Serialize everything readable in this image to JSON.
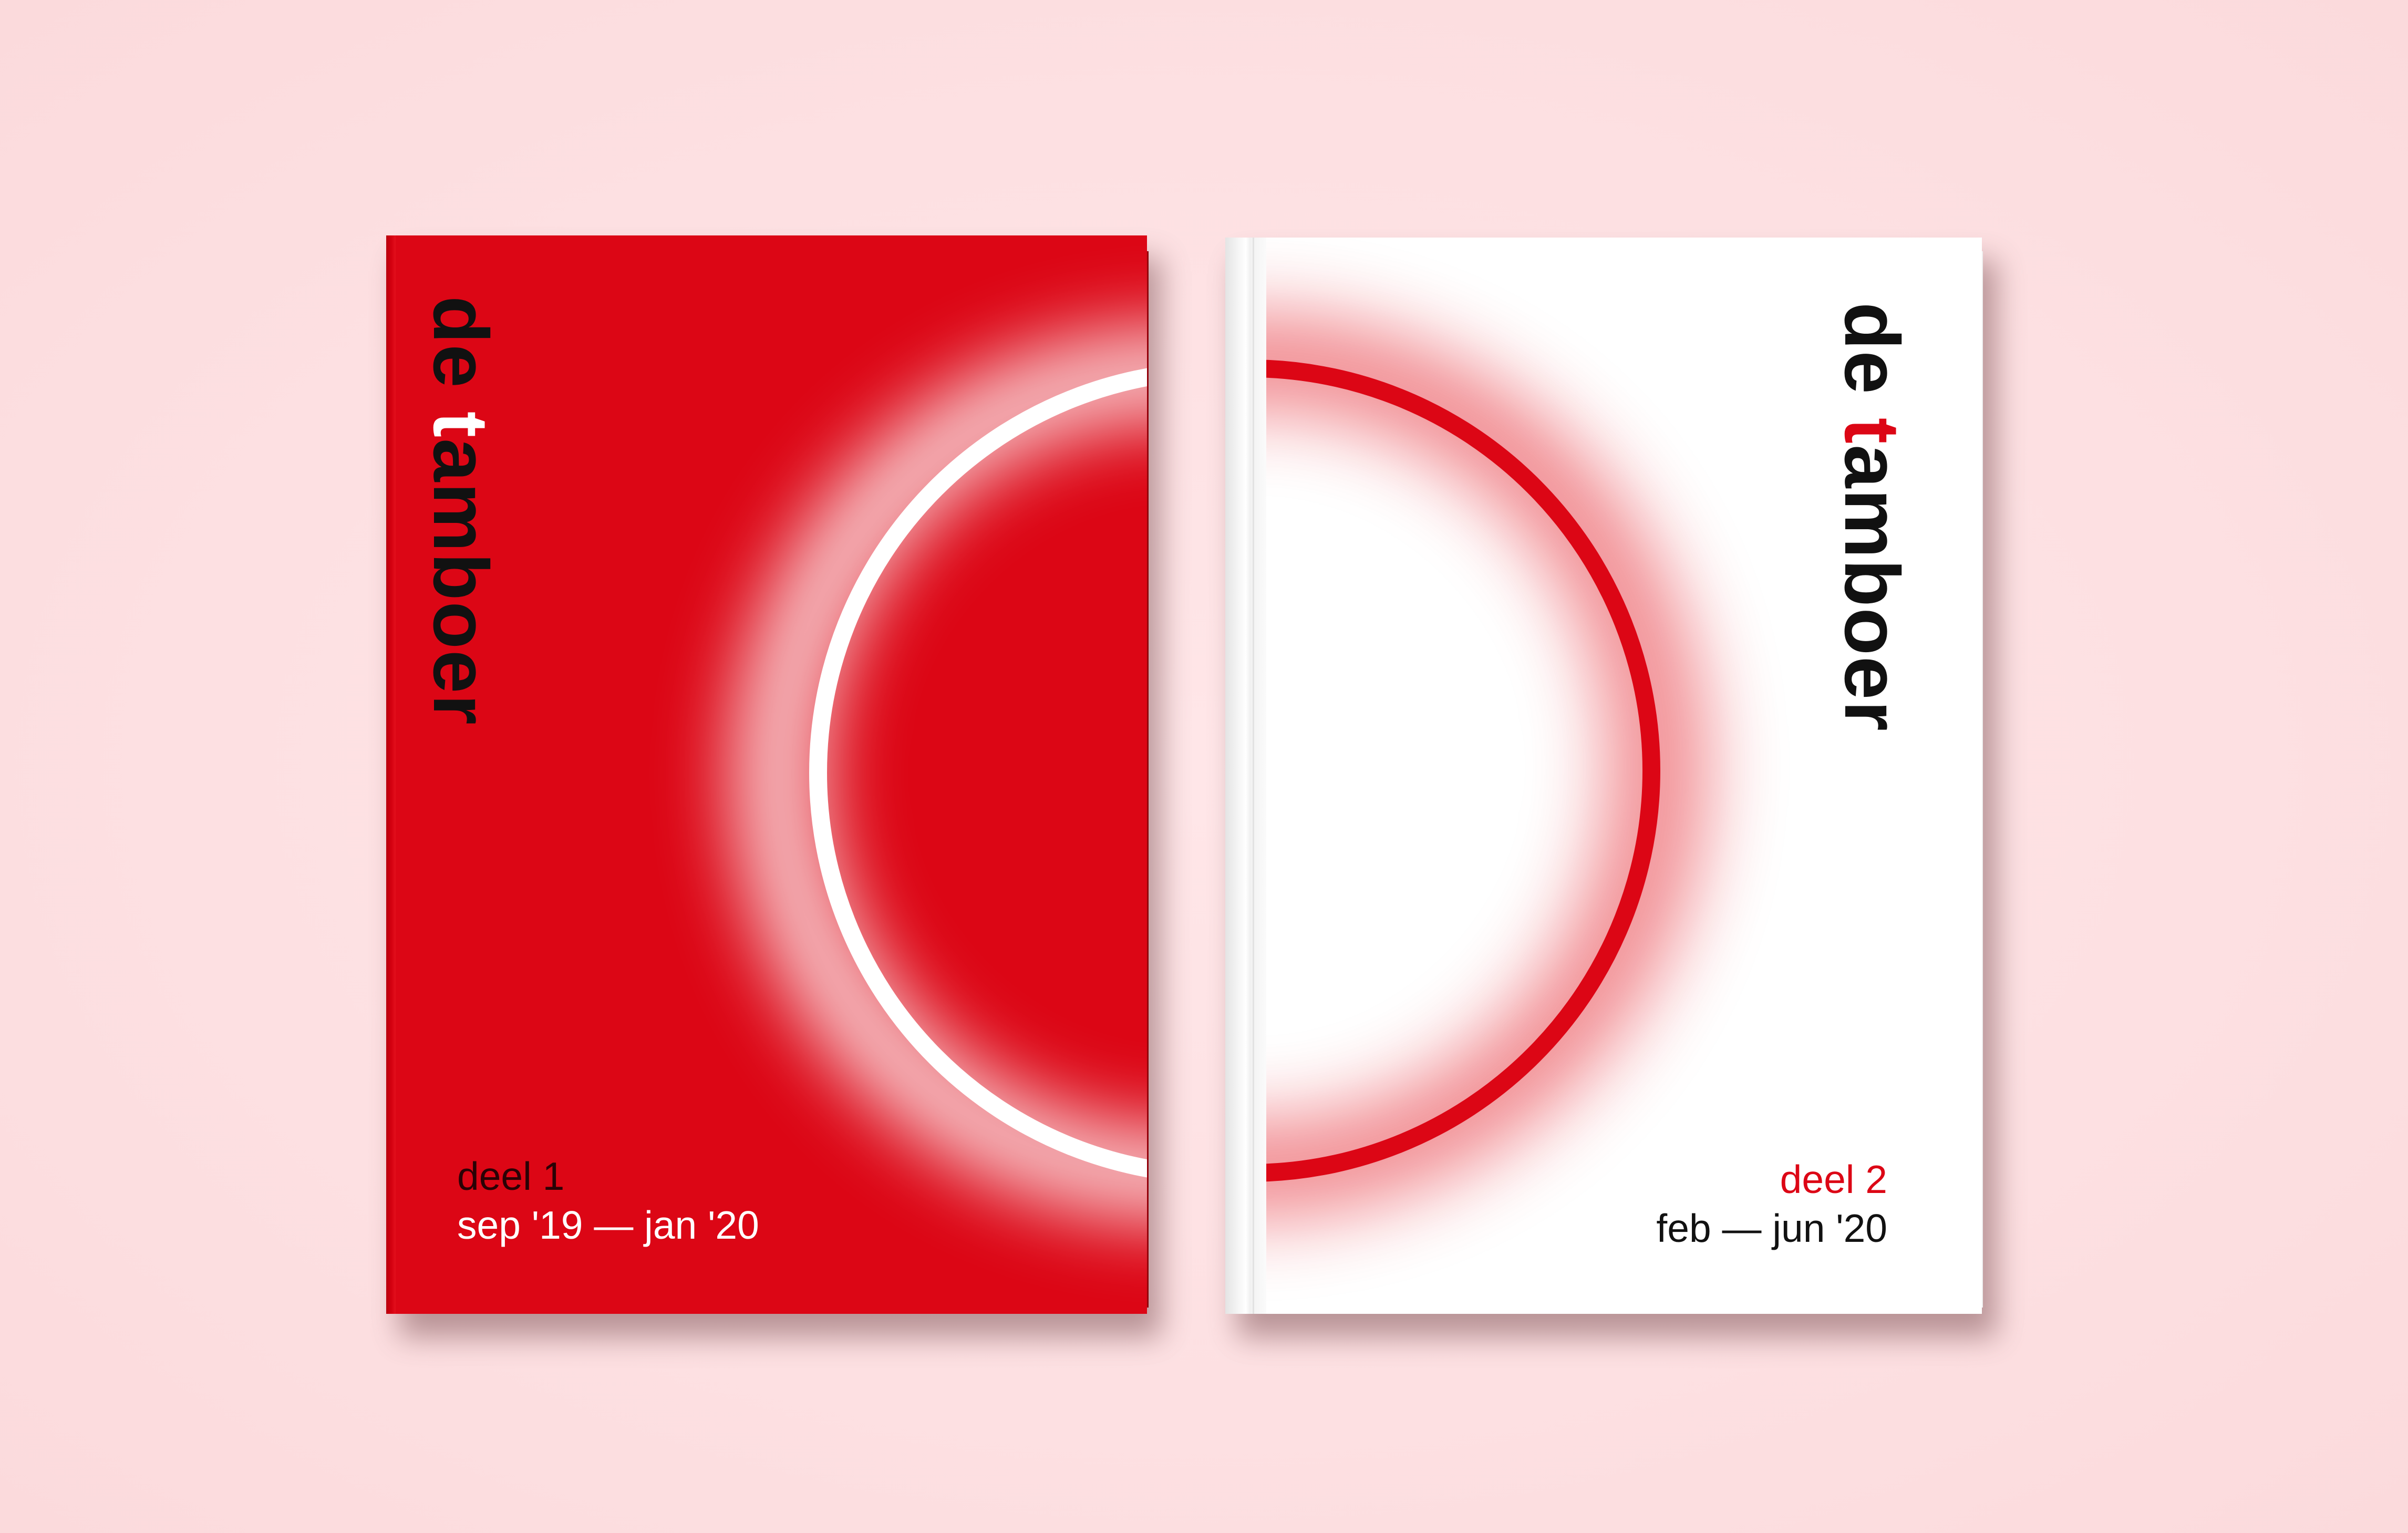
{
  "scene": {
    "background_color": "#fde2e4"
  },
  "covers": [
    {
      "brand_prefix": "de ",
      "brand_highlight": "t",
      "brand_suffix": "amboer",
      "part": "deel 1",
      "period": "sep '19 — jan '20",
      "cover_color": "#dc0615",
      "ring_color": "#ffffff",
      "highlight_color": "#ffffff"
    },
    {
      "brand_prefix": "de ",
      "brand_highlight": "t",
      "brand_suffix": "amboer",
      "part": "deel 2",
      "period": "feb — jun '20",
      "cover_color": "#ffffff",
      "ring_color": "#dc0615",
      "highlight_color": "#dc0615"
    }
  ]
}
